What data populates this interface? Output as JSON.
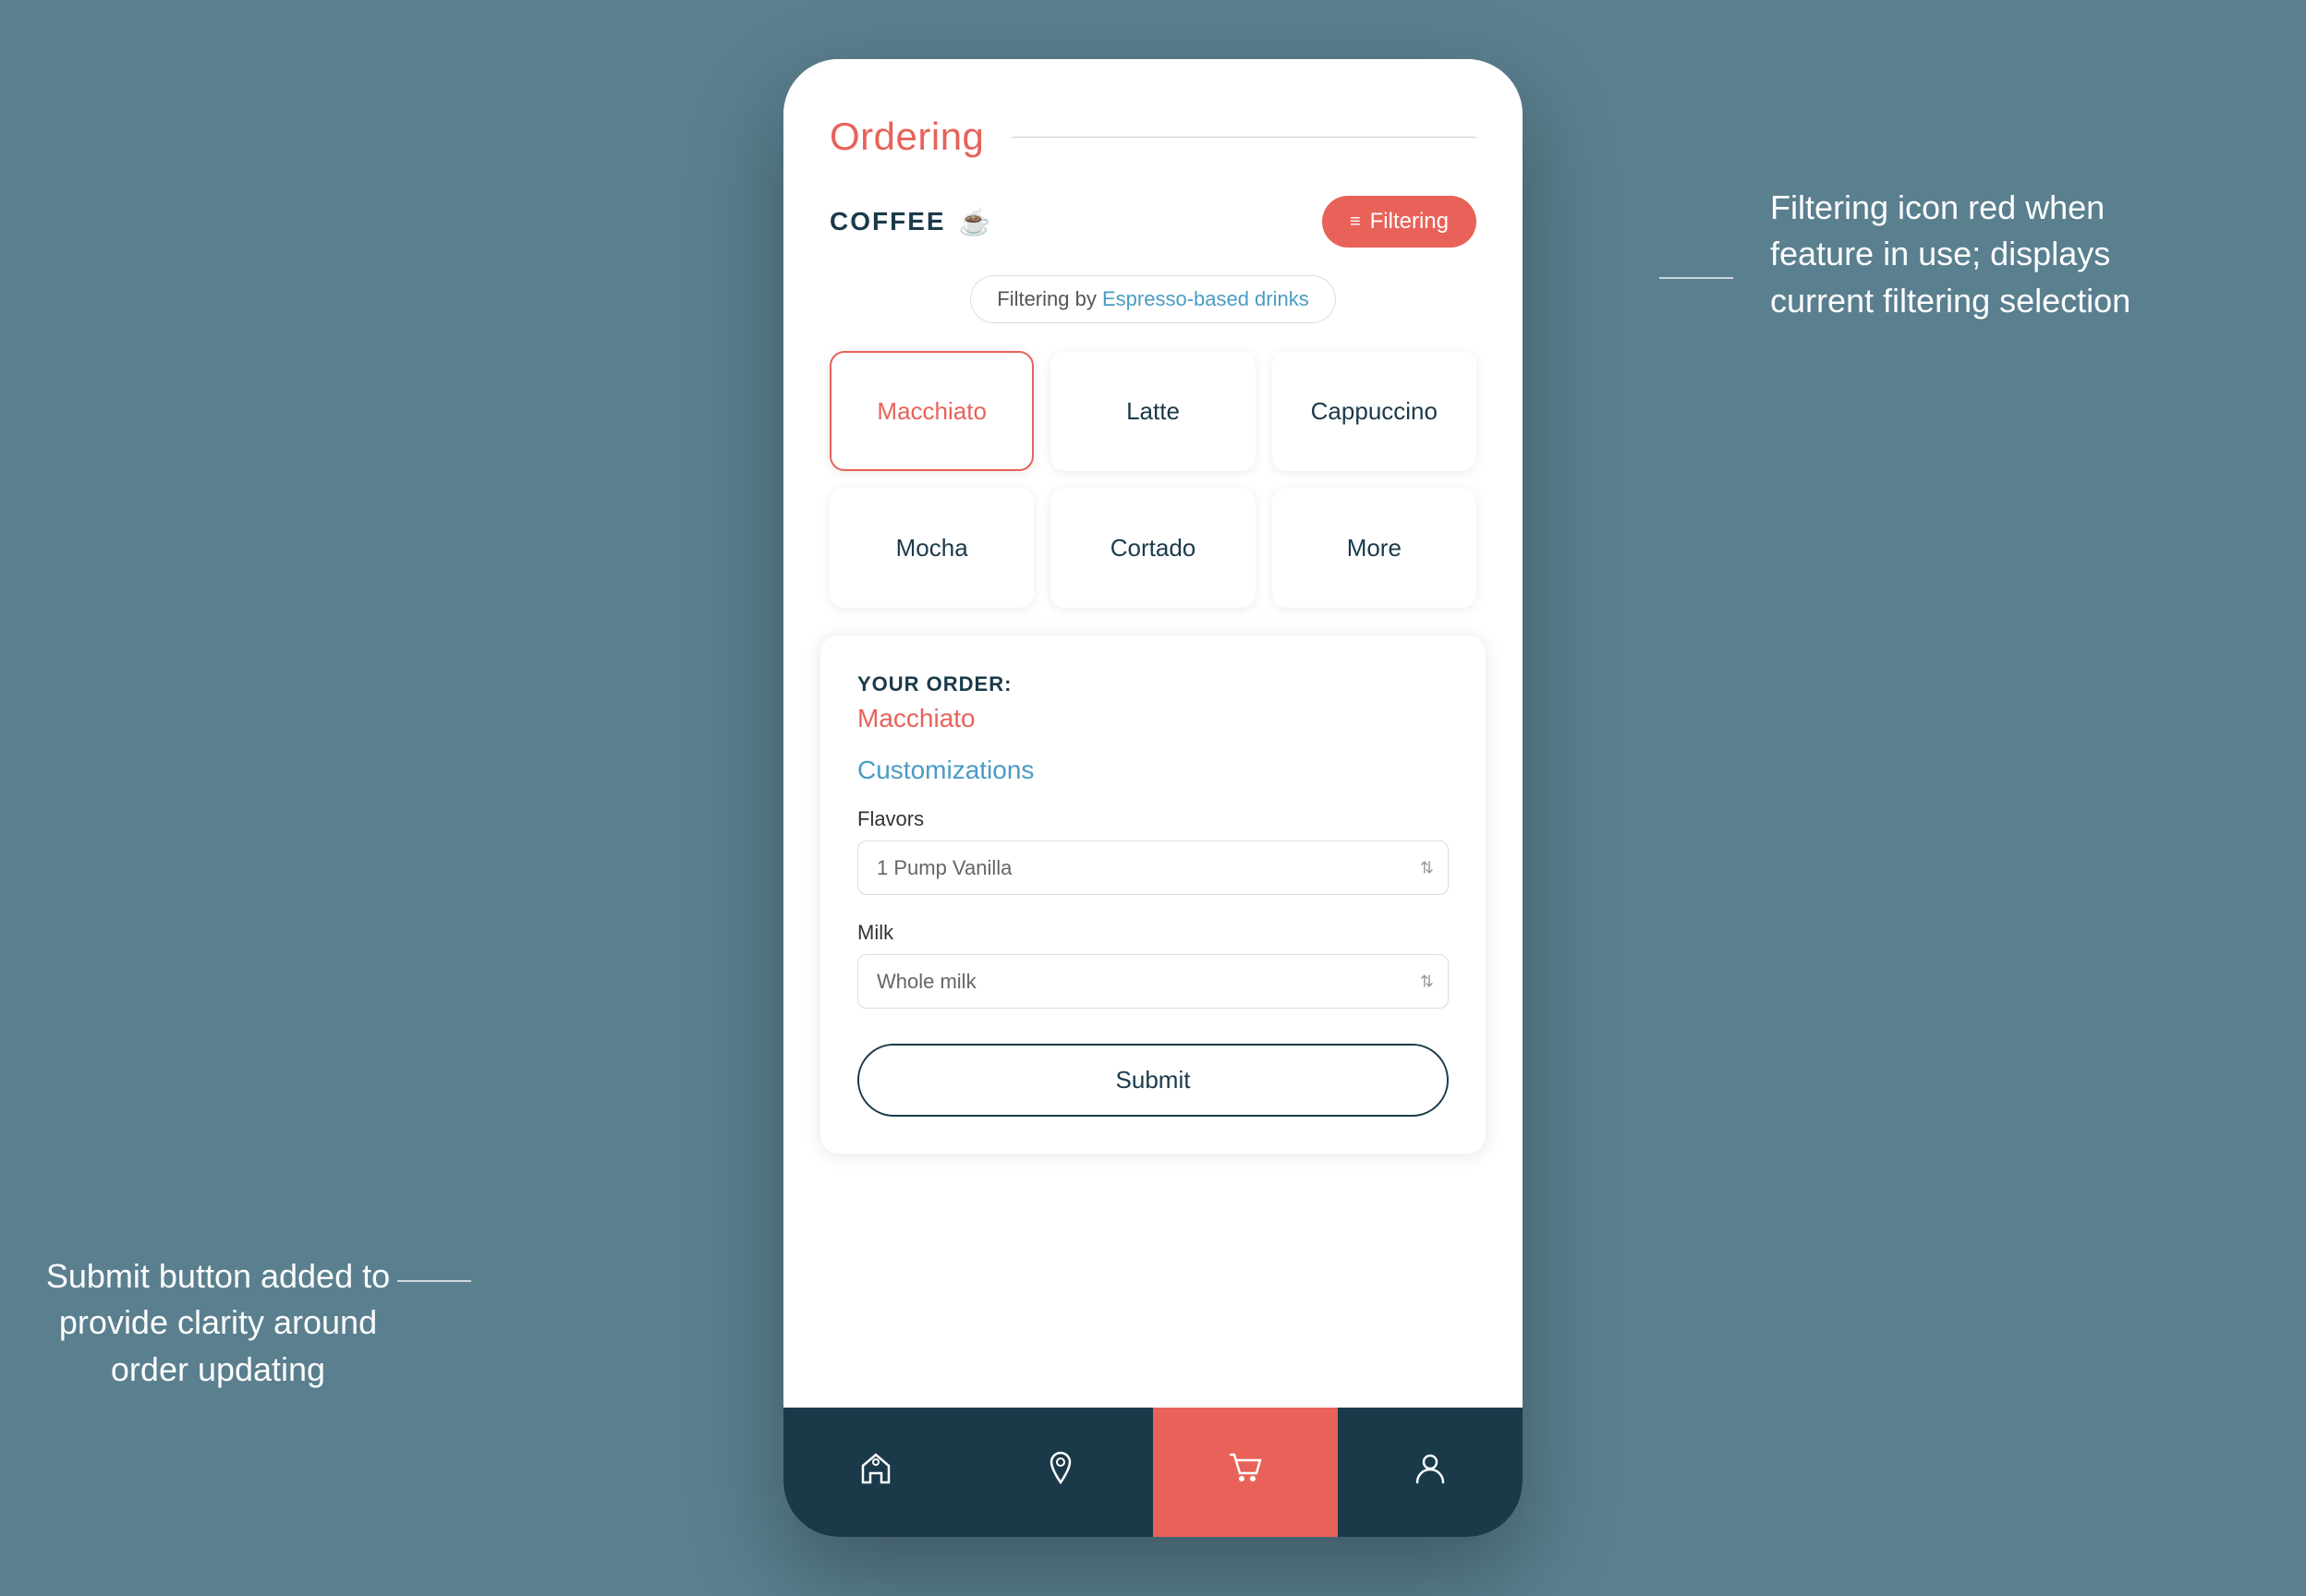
{
  "scene": {
    "background": "#5a7f8f"
  },
  "annotation_left": {
    "text": "Submit button added to provide clarity around order updating",
    "line_visible": true
  },
  "annotation_right": {
    "text": "Filtering icon red when feature in use; displays current filtering selection",
    "line_visible": true
  },
  "phone": {
    "header": {
      "title": "Ordering"
    },
    "coffee_section": {
      "label": "COFFEE",
      "icon": "☕",
      "filter_button": {
        "label": "Filtering",
        "icon": "≡"
      },
      "filter_badge": {
        "prefix": "Filtering by ",
        "value": "Espresso-based drinks"
      }
    },
    "drink_grid": [
      {
        "name": "Macchiato",
        "selected": true
      },
      {
        "name": "Latte",
        "selected": false
      },
      {
        "name": "Cappuccino",
        "selected": false
      },
      {
        "name": "Mocha",
        "selected": false
      },
      {
        "name": "Cortado",
        "selected": false
      },
      {
        "name": "More",
        "selected": false
      }
    ],
    "order_panel": {
      "label": "YOUR ORDER:",
      "item": "Macchiato",
      "customizations_title": "Customizations",
      "flavors": {
        "label": "Flavors",
        "value": "1 Pump Vanilla",
        "placeholder": "1 Pump Vanilla"
      },
      "milk": {
        "label": "Milk",
        "value": "Whole milk",
        "placeholder": "Whole milk"
      },
      "submit_button": "Submit"
    },
    "bottom_nav": [
      {
        "icon": "🏠",
        "name": "home",
        "active": false
      },
      {
        "icon": "📍",
        "name": "location",
        "active": false
      },
      {
        "icon": "🛒",
        "name": "cart",
        "active": true
      },
      {
        "icon": "👤",
        "name": "profile",
        "active": false
      }
    ]
  }
}
